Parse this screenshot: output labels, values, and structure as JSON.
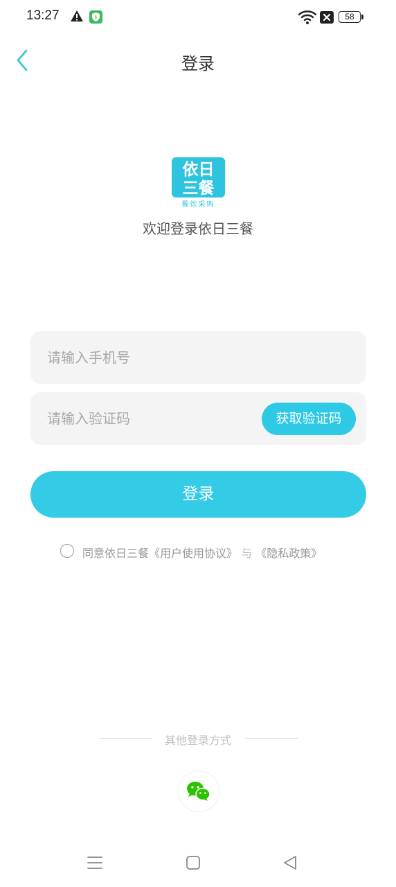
{
  "status_bar": {
    "time": "13:27",
    "battery": "58",
    "icons": [
      "alert-icon",
      "shield-icon",
      "wifi-icon",
      "sim-off-icon",
      "battery-icon"
    ]
  },
  "header": {
    "title": "登录",
    "back_icon": "chevron-left-icon"
  },
  "logo": {
    "line1": "依日",
    "line2": "三餐",
    "tagline": "餐饮采购",
    "color": "#2ec4e0"
  },
  "welcome_text": "欢迎登录依日三餐",
  "form": {
    "phone_placeholder": "请输入手机号",
    "phone_value": "",
    "code_placeholder": "请输入验证码",
    "code_value": "",
    "get_code_label": "获取验证码",
    "login_label": "登录"
  },
  "agreement": {
    "prefix": "同意依日三餐",
    "user_agreement": "《用户使用协议》",
    "connector": "与",
    "privacy_policy": "《隐私政策》",
    "checked": false
  },
  "other_login": {
    "label": "其他登录方式",
    "wechat_icon": "wechat-icon"
  },
  "colors": {
    "accent": "#33cbe6",
    "back_arrow": "#2ec4e0",
    "wechat": "#2dc100"
  },
  "nav_bar": {
    "icons": [
      "menu-icon",
      "home-icon",
      "back-triangle-icon"
    ]
  }
}
